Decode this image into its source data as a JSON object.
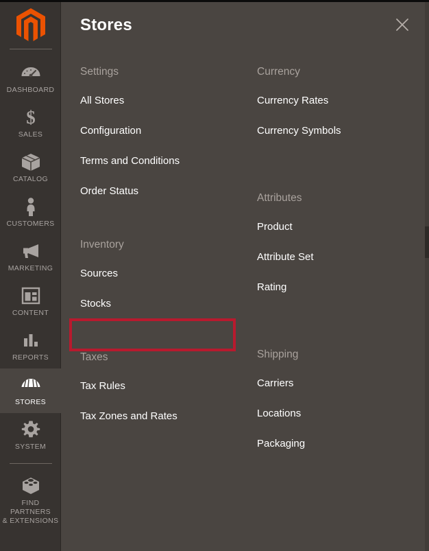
{
  "window": {
    "accent_color": "#eb5202",
    "panel_bg": "#4a4541",
    "sidebar_bg": "#373330",
    "highlight_color": "#b81a2e"
  },
  "sidebar": {
    "logo_name": "magento-logo",
    "items": [
      {
        "label": "DASHBOARD",
        "icon": "dashboard-gauge-icon",
        "active": false
      },
      {
        "label": "SALES",
        "icon": "dollar-sign-icon",
        "active": false
      },
      {
        "label": "CATALOG",
        "icon": "box-icon",
        "active": false
      },
      {
        "label": "CUSTOMERS",
        "icon": "person-icon",
        "active": false
      },
      {
        "label": "MARKETING",
        "icon": "megaphone-icon",
        "active": false
      },
      {
        "label": "CONTENT",
        "icon": "layout-page-icon",
        "active": false
      },
      {
        "label": "REPORTS",
        "icon": "bar-chart-icon",
        "active": false
      },
      {
        "label": "STORES",
        "icon": "storefront-icon",
        "active": true
      },
      {
        "label": "SYSTEM",
        "icon": "gear-icon",
        "active": false
      },
      {
        "label": "FIND PARTNERS\n& EXTENSIONS",
        "icon": "puzzle-brick-icon",
        "active": false
      }
    ],
    "find_partners_line1": "FIND PARTNERS",
    "find_partners_line2": "& EXTENSIONS"
  },
  "panel": {
    "title": "Stores",
    "close_icon": "close-icon",
    "left_column": [
      {
        "heading": "Settings",
        "items": [
          "All Stores",
          "Configuration",
          "Terms and Conditions",
          "Order Status"
        ]
      },
      {
        "heading": "Inventory",
        "items": [
          "Sources",
          "Stocks"
        ]
      },
      {
        "heading": "Taxes",
        "items": [
          "Tax Rules",
          "Tax Zones and Rates"
        ]
      }
    ],
    "right_column": [
      {
        "heading": "Currency",
        "items": [
          "Currency Rates",
          "Currency Symbols"
        ]
      },
      {
        "heading": "Attributes",
        "items": [
          "Product",
          "Attribute Set",
          "Rating"
        ]
      },
      {
        "heading": "Shipping",
        "items": [
          "Carriers",
          "Locations",
          "Packaging"
        ]
      }
    ],
    "highlighted_item": "Stocks"
  }
}
